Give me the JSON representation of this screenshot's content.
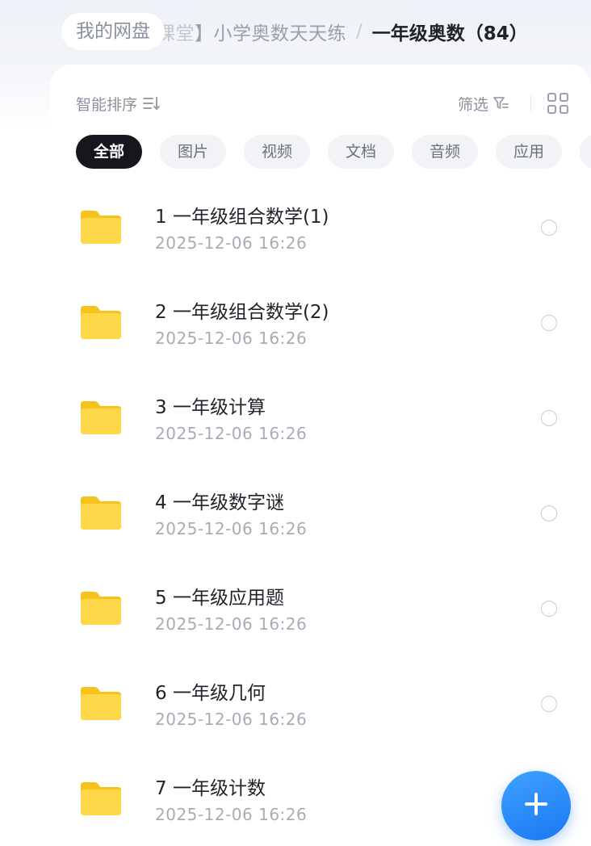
{
  "breadcrumb": {
    "home": "我的网盘",
    "middle_faded": "课堂",
    "middle": "】小学奥数天天练",
    "separator": "/",
    "current": "一年级奥数（84）"
  },
  "toolbar": {
    "sort_label": "智能排序",
    "sort_icon": "sort-icon",
    "filter_label": "筛选",
    "filter_icon": "filter-icon",
    "view_icon": "grid-view-icon"
  },
  "tabs": [
    {
      "label": "全部",
      "active": true
    },
    {
      "label": "图片",
      "active": false
    },
    {
      "label": "视频",
      "active": false
    },
    {
      "label": "文档",
      "active": false
    },
    {
      "label": "音频",
      "active": false
    },
    {
      "label": "应用",
      "active": false
    }
  ],
  "files": [
    {
      "name": "1 一年级组合数学(1)",
      "date": "2025-12-06  16:26",
      "icon": "folder-icon"
    },
    {
      "name": "2 一年级组合数学(2)",
      "date": "2025-12-06  16:26",
      "icon": "folder-icon"
    },
    {
      "name": "3 一年级计算",
      "date": "2025-12-06  16:26",
      "icon": "folder-icon"
    },
    {
      "name": "4 一年级数字谜",
      "date": "2025-12-06  16:26",
      "icon": "folder-icon"
    },
    {
      "name": "5 一年级应用题",
      "date": "2025-12-06  16:26",
      "icon": "folder-icon"
    },
    {
      "name": "6 一年级几何",
      "date": "2025-12-06  16:26",
      "icon": "folder-icon"
    },
    {
      "name": "7 一年级计数",
      "date": "2025-12-06  16:26",
      "icon": "folder-icon"
    }
  ],
  "fab": {
    "icon": "plus-icon"
  },
  "colors": {
    "accent": "#1a78f2",
    "folder": "#ffd23f",
    "active_tab": "#16171c"
  }
}
